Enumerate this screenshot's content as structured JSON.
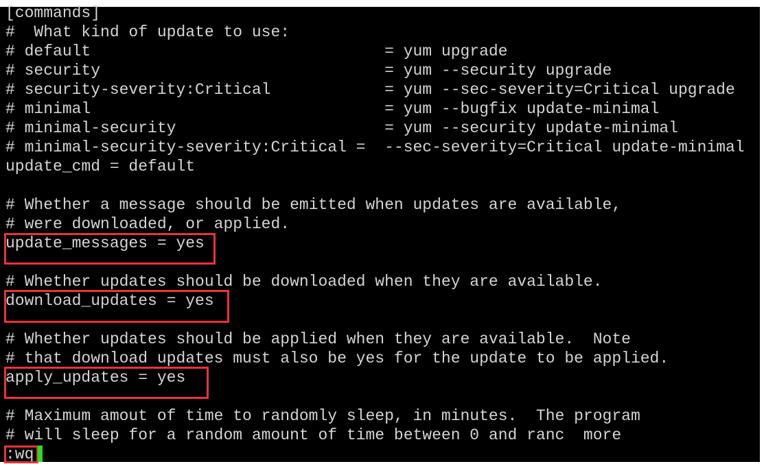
{
  "terminal": {
    "lines": [
      "[commands]",
      "#  What kind of update to use:",
      "# default                               = yum upgrade",
      "# security                              = yum --security upgrade",
      "# security-severity:Critical            = yum --sec-severity=Critical upgrade",
      "# minimal                               = yum --bugfix update-minimal",
      "# minimal-security                      = yum --security update-minimal",
      "# minimal-security-severity:Critical =  --sec-severity=Critical update-minimal",
      "update_cmd = default",
      "",
      "# Whether a message should be emitted when updates are available,",
      "# were downloaded, or applied.",
      "update_messages = yes",
      "",
      "# Whether updates should be downloaded when they are available.",
      "download_updates = yes",
      "",
      "# Whether updates should be applied when they are available.  Note",
      "# that download updates must also be yes for the update to be applied.",
      "apply_updates = yes",
      "",
      "# Maximum amout of time to randomly sleep, in minutes.  The program",
      "# will sleep for a random amount of time between 0 and ranc  more",
      ":wq"
    ],
    "highlight_color": "#e8343a",
    "cursor_color": "#22e022"
  }
}
